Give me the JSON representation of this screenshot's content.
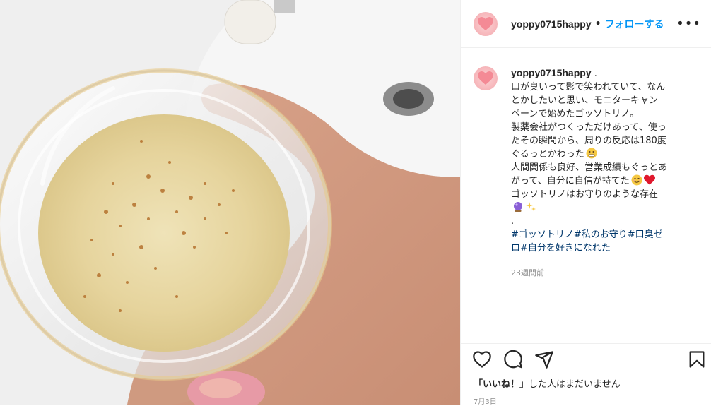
{
  "post": {
    "username": "yoppy0715happy",
    "separator": "•",
    "follow_label": "フォローする",
    "more_label": "•••"
  },
  "caption": {
    "username": "yoppy0715happy",
    "user_suffix": " .",
    "lines": [
      "口が臭いって影で笑われていて、なん",
      "とかしたいと思い、モニターキャン",
      "ペーンで始めたゴッソトリノ。",
      "製薬会社がつくっただけあって、使っ",
      "たその瞬間から、周りの反応は180度",
      "ぐるっとかわった",
      "人間関係も良好、営業成績もぐっとあ",
      "がって、自分に自信が持てた",
      "ゴッソトリノはお守りのような存在",
      "",
      "."
    ],
    "hashtags_line1": "#ゴッソトリノ#私のお守り#口臭ゼ",
    "hashtags_line2": "ロ#自分を好きになれた",
    "time_ago": "23週間前"
  },
  "engagement": {
    "likes_bold": "「いいね！」",
    "likes_rest": "した人はまだいません",
    "date": "7月3日"
  },
  "icons": {
    "like": "heart-icon",
    "comment": "comment-icon",
    "share": "share-icon",
    "save": "bookmark-icon"
  },
  "colors": {
    "link": "#0095f6",
    "hashtag": "#00376b",
    "muted": "#8e8e8e",
    "text": "#262626"
  }
}
